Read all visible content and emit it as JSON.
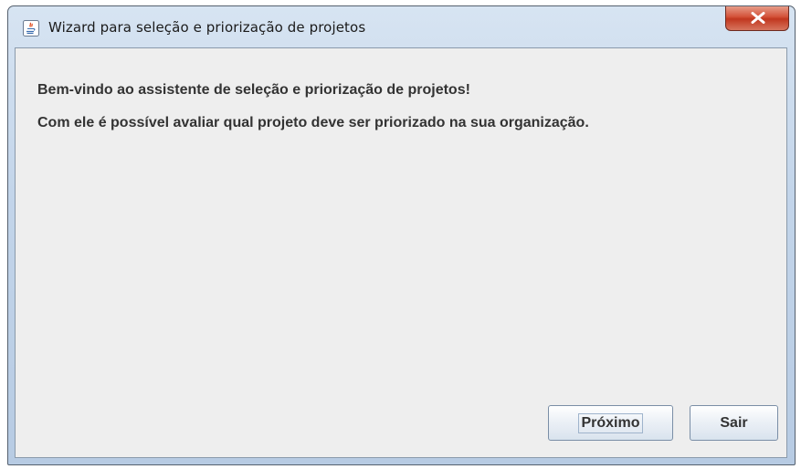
{
  "window": {
    "title": "Wizard para seleção e priorização de projetos",
    "icon": "java-icon",
    "close_icon": "close-icon"
  },
  "content": {
    "welcome_line": "Bem-vindo ao assistente de seleção e priorização de projetos!",
    "description_line": "Com ele é possível avaliar qual projeto deve ser priorizado na sua organização."
  },
  "buttons": {
    "next_label": "Próximo",
    "exit_label": "Sair"
  },
  "colors": {
    "client_background": "#eeeeee",
    "close_button": "#c1371f",
    "text": "#333333"
  }
}
